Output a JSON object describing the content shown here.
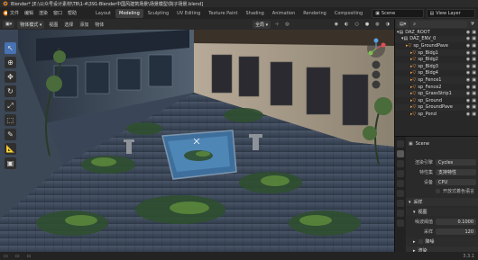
{
  "title_bar": {
    "text": "Blender* [E:\\公众号设计素材\\TB\\1-4\\391-Blender中国风建筑场景\\场景模型\\院子场景.blend]"
  },
  "menu": {
    "items": [
      "文件",
      "编辑",
      "渲染",
      "窗口",
      "帮助"
    ],
    "workspaces": [
      "Layout",
      "Modeling",
      "Sculpting",
      "UV Editing",
      "Texture Paint",
      "Shading",
      "Animation",
      "Rendering",
      "Compositing"
    ],
    "active_workspace": "Modeling",
    "scene": "Scene",
    "view_layer": "View Layer"
  },
  "viewport_header": {
    "mode": "物体模式",
    "items": [
      "视图",
      "选择",
      "添加",
      "物体"
    ],
    "transform": "全局"
  },
  "outliner": {
    "rows": [
      {
        "name": "DAZ_ROOT",
        "depth": 0
      },
      {
        "name": "DAZ_ENV_0",
        "depth": 1
      },
      {
        "name": "sp_GroundPave",
        "depth": 2
      },
      {
        "name": "sp_Bldg1",
        "depth": 3
      },
      {
        "name": "sp_Bldg2",
        "depth": 3
      },
      {
        "name": "sp_Bldg3",
        "depth": 3
      },
      {
        "name": "sp_Bldg4",
        "depth": 3
      },
      {
        "name": "sp_Fence1",
        "depth": 3
      },
      {
        "name": "sp_Fence2",
        "depth": 3
      },
      {
        "name": "sp_GrassStrip1",
        "depth": 3
      },
      {
        "name": "sp_Ground",
        "depth": 3
      },
      {
        "name": "sp_GroundPave",
        "depth": 3
      },
      {
        "name": "sp_Pond",
        "depth": 3
      }
    ]
  },
  "properties": {
    "scene_name": "Scene",
    "render_engine_label": "渲染引擎",
    "render_engine": "Cycles",
    "feature_set_label": "特性集",
    "feature_set": "支持特性",
    "device_label": "设备",
    "device": "CPU",
    "osl_label": "开放式着色语言",
    "sampling_section": "采样",
    "viewport_section": "视图",
    "noise_threshold_label": "噪波阈值",
    "noise_threshold": "0.1000",
    "max_samples_label": "采样",
    "max_samples": "120",
    "denoise_label": "降噪",
    "render_section": "渲染"
  },
  "status_bar": {
    "version": "3.3.1"
  },
  "colors": {
    "accent": "#4772b3",
    "active_workspace_bg": "#3d3d3d"
  }
}
